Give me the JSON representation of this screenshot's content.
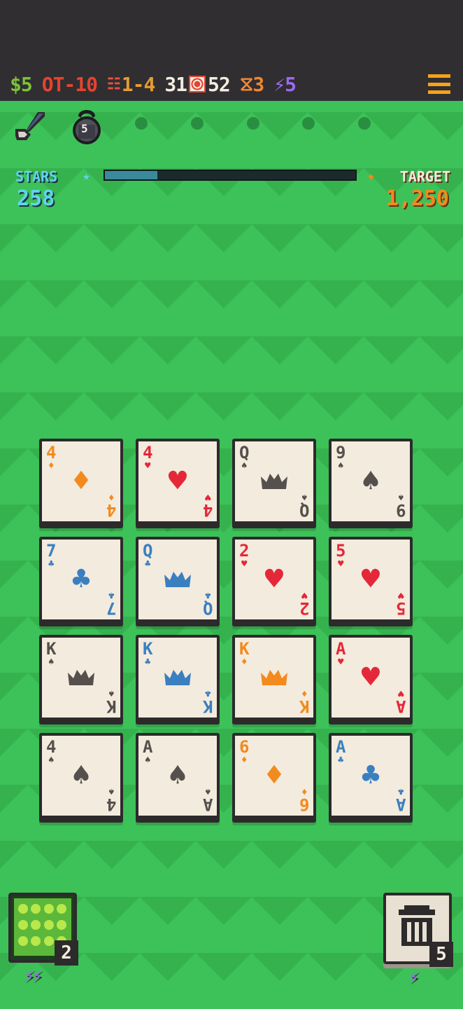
{
  "hud": {
    "money": "$5",
    "round": "OT-10",
    "stage": "1-4",
    "deck_left": "31",
    "deck_total": "52",
    "hands": "3",
    "energy": "5"
  },
  "tools": {
    "weight_count": "5"
  },
  "progress": {
    "stars_label": "STARS",
    "stars_value": "258",
    "target_label": "TARGET",
    "target_value": "1,250",
    "fill_fraction": 0.21
  },
  "cards": [
    {
      "rank": "4",
      "suit": "diamond",
      "color": "orange"
    },
    {
      "rank": "4",
      "suit": "heart",
      "color": "red"
    },
    {
      "rank": "Q",
      "suit": "spade",
      "color": "dark"
    },
    {
      "rank": "9",
      "suit": "spade",
      "color": "dark"
    },
    {
      "rank": "7",
      "suit": "club",
      "color": "blue"
    },
    {
      "rank": "Q",
      "suit": "club",
      "color": "blue"
    },
    {
      "rank": "2",
      "suit": "heart",
      "color": "red"
    },
    {
      "rank": "5",
      "suit": "heart",
      "color": "red"
    },
    {
      "rank": "K",
      "suit": "spade",
      "color": "dark"
    },
    {
      "rank": "K",
      "suit": "club",
      "color": "blue"
    },
    {
      "rank": "K",
      "suit": "diamond",
      "color": "orange"
    },
    {
      "rank": "A",
      "suit": "heart",
      "color": "red"
    },
    {
      "rank": "4",
      "suit": "spade",
      "color": "dark"
    },
    {
      "rank": "A",
      "suit": "spade",
      "color": "dark"
    },
    {
      "rank": "6",
      "suit": "diamond",
      "color": "orange"
    },
    {
      "rank": "A",
      "suit": "club",
      "color": "blue"
    }
  ],
  "deck_button": {
    "count": "2",
    "cost": "⚡⚡",
    "icon": "deck-icon"
  },
  "trash_button": {
    "count": "5",
    "cost": "⚡",
    "icon": "trash-icon"
  },
  "colors": {
    "felt": "#3cc258",
    "felt_dark": "#35b24e",
    "hud_bg": "#302e31",
    "card_bg": "#f3ebdd"
  }
}
